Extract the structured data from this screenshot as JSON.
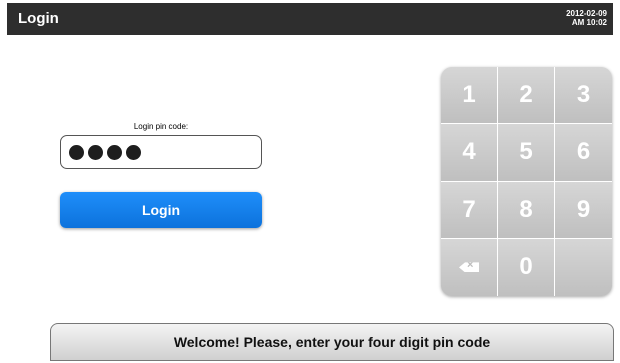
{
  "header": {
    "title": "Login",
    "date": "2012-02-09",
    "time": "AM 10:02"
  },
  "pin": {
    "label": "Login pin code:",
    "digits_entered": 4
  },
  "login_button": {
    "label": "Login"
  },
  "keypad": {
    "keys": [
      "1",
      "2",
      "3",
      "4",
      "5",
      "6",
      "7",
      "8",
      "9",
      "",
      "0",
      ""
    ],
    "backspace_icon": "backspace-icon"
  },
  "welcome": {
    "message": "Welcome! Please, enter your four digit pin code"
  },
  "colors": {
    "titlebar": "#2e2e2e",
    "accent": "#1480ee",
    "keypad": "#c8c8c8"
  }
}
